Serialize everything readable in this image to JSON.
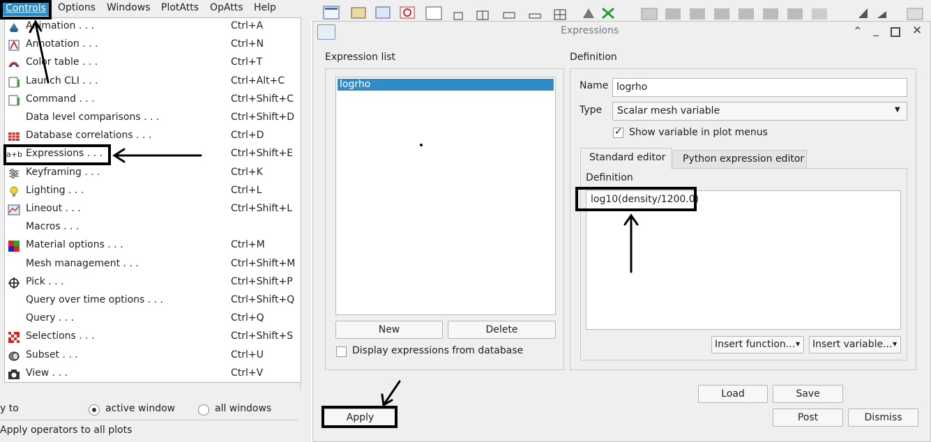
{
  "menubar": {
    "items": [
      "Controls",
      "Options",
      "Windows",
      "PlotAtts",
      "OpAtts",
      "Help"
    ]
  },
  "controls_menu": {
    "items": [
      {
        "label": "Animation . . .",
        "shortcut": "Ctrl+A",
        "icon": "animation-icon"
      },
      {
        "label": "Annotation . . .",
        "shortcut": "Ctrl+N",
        "icon": "annotation-icon"
      },
      {
        "label": "Color table . . .",
        "shortcut": "Ctrl+T",
        "icon": "color-table-icon"
      },
      {
        "label": "Launch CLI . . .",
        "shortcut": "Ctrl+Alt+C",
        "icon": "cli-icon"
      },
      {
        "label": "Command . . .",
        "shortcut": "Ctrl+Shift+C",
        "icon": "command-icon"
      },
      {
        "label": "Data level comparisons . . .",
        "shortcut": "Ctrl+Shift+D",
        "icon": ""
      },
      {
        "label": "Database correlations . . .",
        "shortcut": "Ctrl+D",
        "icon": "database-correlation-icon"
      },
      {
        "label": "Expressions . . .",
        "shortcut": "Ctrl+Shift+E",
        "icon": "expressions-icon"
      },
      {
        "label": "Keyframing . . .",
        "shortcut": "Ctrl+K",
        "icon": "keyframing-icon"
      },
      {
        "label": "Lighting . . .",
        "shortcut": "Ctrl+L",
        "icon": "lightbulb-icon"
      },
      {
        "label": "Lineout . . .",
        "shortcut": "Ctrl+Shift+L",
        "icon": "lineout-icon"
      },
      {
        "label": "Macros . . .",
        "shortcut": "",
        "icon": ""
      },
      {
        "label": "Material options . . .",
        "shortcut": "Ctrl+M",
        "icon": "material-icon"
      },
      {
        "label": "Mesh management . . .",
        "shortcut": "Ctrl+Shift+M",
        "icon": ""
      },
      {
        "label": "Pick . . .",
        "shortcut": "Ctrl+Shift+P",
        "icon": "pick-crosshair-icon"
      },
      {
        "label": "Query over time options . . .",
        "shortcut": "Ctrl+Shift+Q",
        "icon": ""
      },
      {
        "label": "Query . . .",
        "shortcut": "Ctrl+Q",
        "icon": ""
      },
      {
        "label": "Selections . . .",
        "shortcut": "Ctrl+Shift+S",
        "icon": "selections-icon"
      },
      {
        "label": "Subset . . .",
        "shortcut": "Ctrl+U",
        "icon": "subset-icon"
      },
      {
        "label": "View . . .",
        "shortcut": "Ctrl+V",
        "icon": "camera-icon"
      }
    ],
    "expressions_icon_text": "a+b"
  },
  "left_panel": {
    "apply_to_label": "y to",
    "active_window": "active window",
    "all_windows": "all windows",
    "apply_operators": "Apply operators to all plots"
  },
  "dialog": {
    "title": "Expressions",
    "expression_list_label": "Expression list",
    "expressions": [
      "logrho"
    ],
    "new_button": "New",
    "delete_button": "Delete",
    "display_from_db": "Display expressions from database",
    "definition_group": "Definition",
    "name_label": "Name",
    "name_value": "logrho",
    "type_label": "Type",
    "type_value": "Scalar mesh variable",
    "show_in_menus": "Show variable in plot menus",
    "tabs": [
      "Standard editor",
      "Python expression editor"
    ],
    "definition_label": "Definition",
    "definition_text": "log10(density/1200.0)",
    "insert_function": "Insert function...",
    "insert_variable": "Insert variable...",
    "load_button": "Load",
    "save_button": "Save",
    "apply_button": "Apply",
    "post_button": "Post",
    "dismiss_button": "Dismiss"
  },
  "colors": {
    "menu_highlight": "#308cc6",
    "selection": "#308cc6",
    "window_bg": "#efefef"
  }
}
